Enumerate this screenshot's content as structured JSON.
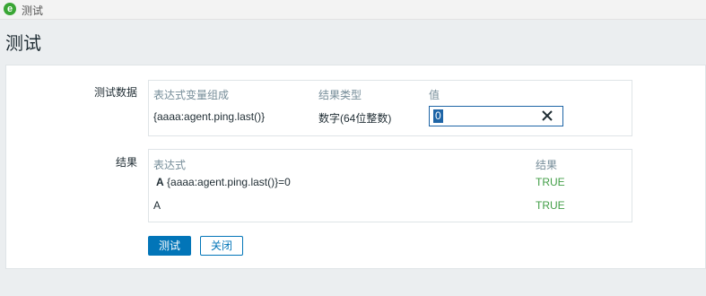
{
  "window": {
    "icon": "e",
    "title": "测试"
  },
  "page": {
    "title": "测试"
  },
  "test_data": {
    "label": "测试数据",
    "headers": {
      "expression_var": "表达式变量组成",
      "result_type": "结果类型",
      "value": "值"
    },
    "row": {
      "expression_var": "{aaaa:agent.ping.last()}",
      "result_type": "数字(64位整数)",
      "value": "0"
    }
  },
  "result": {
    "label": "结果",
    "headers": {
      "expression": "表达式",
      "result": "结果"
    },
    "rows": [
      {
        "prefix": "A",
        "expression": "{aaaa:agent.ping.last()}=0",
        "result": "TRUE"
      },
      {
        "prefix": "",
        "expression": "A",
        "result": "TRUE"
      }
    ]
  },
  "buttons": {
    "test": "测试",
    "close": "关闭"
  },
  "colors": {
    "accent": "#0275b8",
    "success": "#429e47",
    "header_text": "#768d99"
  },
  "icons": {
    "clear": "close-icon",
    "app": "app-icon"
  }
}
